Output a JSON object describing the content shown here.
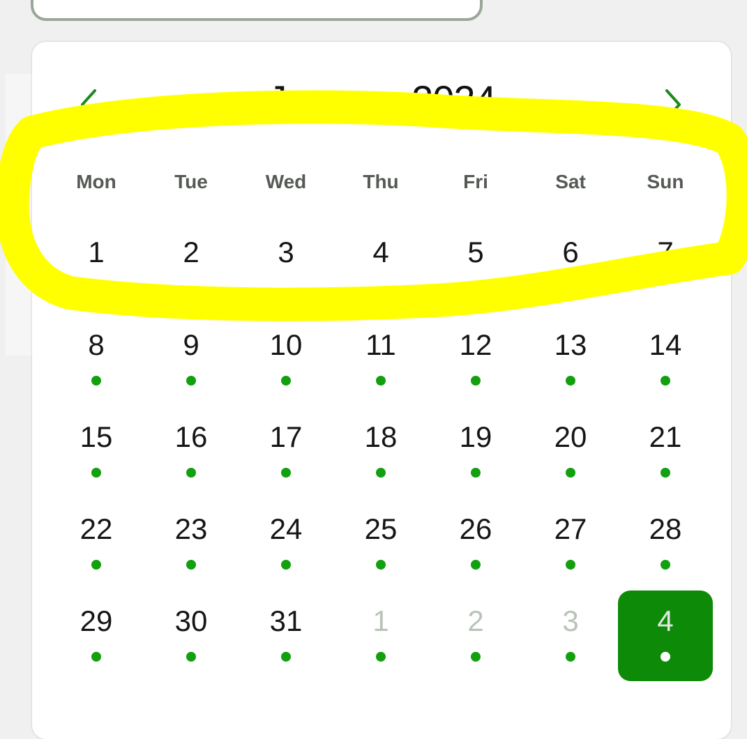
{
  "calendar": {
    "month_title": "January 2024",
    "prev_icon": "chevron-left-icon",
    "next_icon": "chevron-right-icon",
    "weekdays": [
      "Mon",
      "Tue",
      "Wed",
      "Thu",
      "Fri",
      "Sat",
      "Sun"
    ],
    "weeks": [
      [
        {
          "d": "1",
          "dot": false,
          "muted": false,
          "sel": false
        },
        {
          "d": "2",
          "dot": false,
          "muted": false,
          "sel": false
        },
        {
          "d": "3",
          "dot": false,
          "muted": false,
          "sel": false
        },
        {
          "d": "4",
          "dot": false,
          "muted": false,
          "sel": false
        },
        {
          "d": "5",
          "dot": false,
          "muted": false,
          "sel": false
        },
        {
          "d": "6",
          "dot": false,
          "muted": false,
          "sel": false
        },
        {
          "d": "7",
          "dot": false,
          "muted": false,
          "sel": false
        }
      ],
      [
        {
          "d": "8",
          "dot": true,
          "muted": false,
          "sel": false
        },
        {
          "d": "9",
          "dot": true,
          "muted": false,
          "sel": false
        },
        {
          "d": "10",
          "dot": true,
          "muted": false,
          "sel": false
        },
        {
          "d": "11",
          "dot": true,
          "muted": false,
          "sel": false
        },
        {
          "d": "12",
          "dot": true,
          "muted": false,
          "sel": false
        },
        {
          "d": "13",
          "dot": true,
          "muted": false,
          "sel": false
        },
        {
          "d": "14",
          "dot": true,
          "muted": false,
          "sel": false
        }
      ],
      [
        {
          "d": "15",
          "dot": true,
          "muted": false,
          "sel": false
        },
        {
          "d": "16",
          "dot": true,
          "muted": false,
          "sel": false
        },
        {
          "d": "17",
          "dot": true,
          "muted": false,
          "sel": false
        },
        {
          "d": "18",
          "dot": true,
          "muted": false,
          "sel": false
        },
        {
          "d": "19",
          "dot": true,
          "muted": false,
          "sel": false
        },
        {
          "d": "20",
          "dot": true,
          "muted": false,
          "sel": false
        },
        {
          "d": "21",
          "dot": true,
          "muted": false,
          "sel": false
        }
      ],
      [
        {
          "d": "22",
          "dot": true,
          "muted": false,
          "sel": false
        },
        {
          "d": "23",
          "dot": true,
          "muted": false,
          "sel": false
        },
        {
          "d": "24",
          "dot": true,
          "muted": false,
          "sel": false
        },
        {
          "d": "25",
          "dot": true,
          "muted": false,
          "sel": false
        },
        {
          "d": "26",
          "dot": true,
          "muted": false,
          "sel": false
        },
        {
          "d": "27",
          "dot": true,
          "muted": false,
          "sel": false
        },
        {
          "d": "28",
          "dot": true,
          "muted": false,
          "sel": false
        }
      ],
      [
        {
          "d": "29",
          "dot": true,
          "muted": false,
          "sel": false
        },
        {
          "d": "30",
          "dot": true,
          "muted": false,
          "sel": false
        },
        {
          "d": "31",
          "dot": true,
          "muted": false,
          "sel": false
        },
        {
          "d": "1",
          "dot": true,
          "muted": true,
          "sel": false
        },
        {
          "d": "2",
          "dot": true,
          "muted": true,
          "sel": false
        },
        {
          "d": "3",
          "dot": true,
          "muted": true,
          "sel": false
        },
        {
          "d": "4",
          "dot": true,
          "muted": false,
          "sel": true
        }
      ]
    ]
  },
  "colors": {
    "accent": "#0d8a07",
    "dot": "#13a00f",
    "highlighter": "#ffff00",
    "muted_text": "#b9c4b9",
    "weekday_text": "#555a55"
  }
}
